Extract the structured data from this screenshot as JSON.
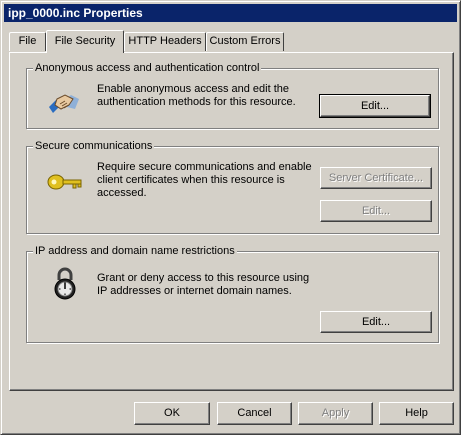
{
  "window": {
    "title": "ipp_0000.inc Properties"
  },
  "tabs": [
    {
      "label": "File"
    },
    {
      "label": "File Security"
    },
    {
      "label": "HTTP Headers"
    },
    {
      "label": "Custom Errors"
    }
  ],
  "groups": {
    "anonymous": {
      "label": "Anonymous access and authentication control",
      "description": "Enable anonymous access and edit the\nauthentication methods for this resource.",
      "edit_label": "Edit...",
      "icon": "handshake-icon"
    },
    "secure": {
      "label": "Secure communications",
      "description": "Require secure communications and enable\nclient certificates when this resource is\naccessed.",
      "server_cert_label": "Server Certificate...",
      "edit_label": "Edit...",
      "icon": "key-icon"
    },
    "ip": {
      "label": "IP address and domain name restrictions",
      "description": "Grant or deny access to this resource using\nIP addresses or internet domain names.",
      "edit_label": "Edit...",
      "icon": "padlock-icon"
    }
  },
  "buttons": {
    "ok": "OK",
    "cancel": "Cancel",
    "apply": "Apply",
    "help": "Help"
  }
}
